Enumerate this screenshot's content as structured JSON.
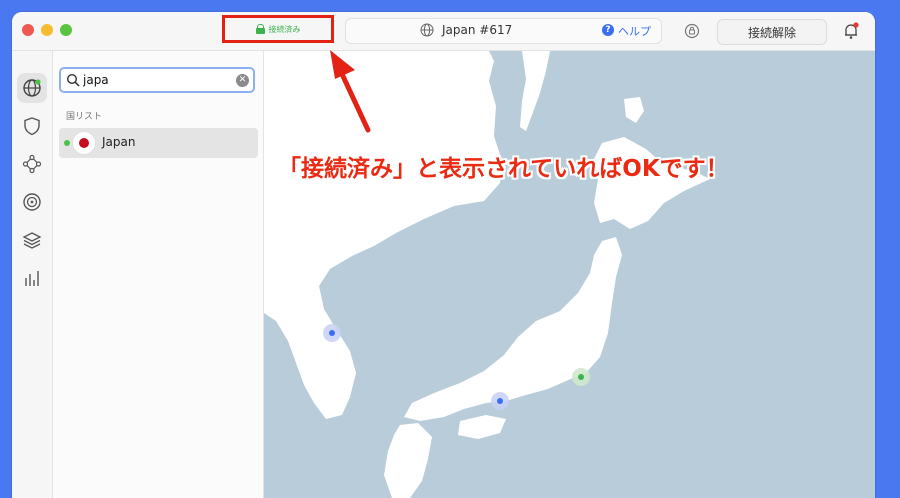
{
  "titlebar": {
    "status_label": "接続済み",
    "server_name": "Japan #617",
    "help_label": "ヘルプ",
    "disconnect_label": "接続解除"
  },
  "search": {
    "value": "japa"
  },
  "country_list": {
    "section_label": "国リスト",
    "items": [
      {
        "name": "Japan",
        "status": "connected"
      }
    ]
  },
  "annotation": {
    "text": "「接続済み」と表示されていればOKです！"
  },
  "colors": {
    "accent_blue": "#3b6df0",
    "connected_green": "#3bb24a",
    "annotation_red": "#e22215",
    "map_water": "#b8ccd9",
    "map_land": "#ffffff",
    "background": "#4a78f0"
  },
  "icons": {
    "rail": [
      "globe-icon",
      "shield-icon",
      "mesh-network-icon",
      "target-icon",
      "layers-icon",
      "stats-icon"
    ]
  }
}
